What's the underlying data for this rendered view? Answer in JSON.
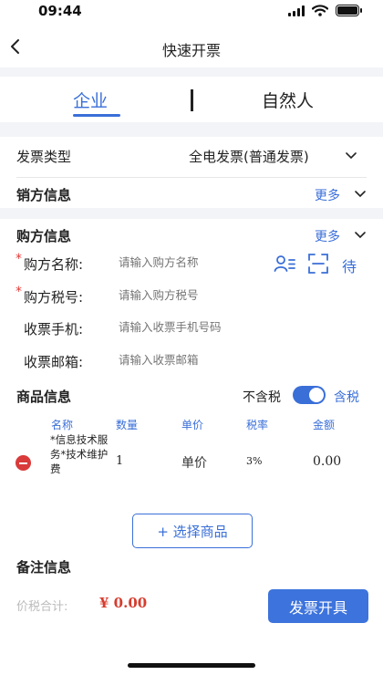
{
  "status": {
    "time": "09:44"
  },
  "nav": {
    "title": "快速开票",
    "back_icon": "chevron-left-icon"
  },
  "tabs": [
    {
      "label": "企业",
      "active": true
    },
    {
      "label": "自然人",
      "active": false
    }
  ],
  "invoice_type": {
    "label": "发票类型",
    "value": "全电发票(普通发票)"
  },
  "seller": {
    "title": "销方信息",
    "more": "更多"
  },
  "buyer": {
    "title": "购方信息",
    "more": "更多",
    "fields": [
      {
        "label": "购方名称:",
        "placeholder": "请输入购方名称",
        "required": true
      },
      {
        "label": "购方税号:",
        "placeholder": "请输入购方税号",
        "required": true
      },
      {
        "label": "收票手机:",
        "placeholder": "请输入收票手机号码",
        "required": false
      },
      {
        "label": "收票邮箱:",
        "placeholder": "请输入收票邮箱",
        "required": false
      }
    ],
    "pending_label": "待"
  },
  "goods": {
    "title": "商品信息",
    "tax_exclusive_label": "不含税",
    "tax_inclusive_label": "含税",
    "tax_toggle_on": true,
    "headers": [
      "名称",
      "数量",
      "单价",
      "税率",
      "金额"
    ],
    "items": [
      {
        "name": "*信息技术服务*技术维护费",
        "quantity": "1",
        "unit_price": "单价",
        "tax_rate": "3%",
        "amount": "0.00"
      }
    ],
    "select_button": "+ 选择商品"
  },
  "remark": {
    "title": "备注信息"
  },
  "footer": {
    "total_label": "价税合计:",
    "total_value": "¥ 0.00",
    "issue_button": "发票开具"
  },
  "colors": {
    "accent": "#3a6fd8",
    "danger": "#d93a3a",
    "price": "#d63c2e",
    "section_bg": "#f2f4f7"
  }
}
